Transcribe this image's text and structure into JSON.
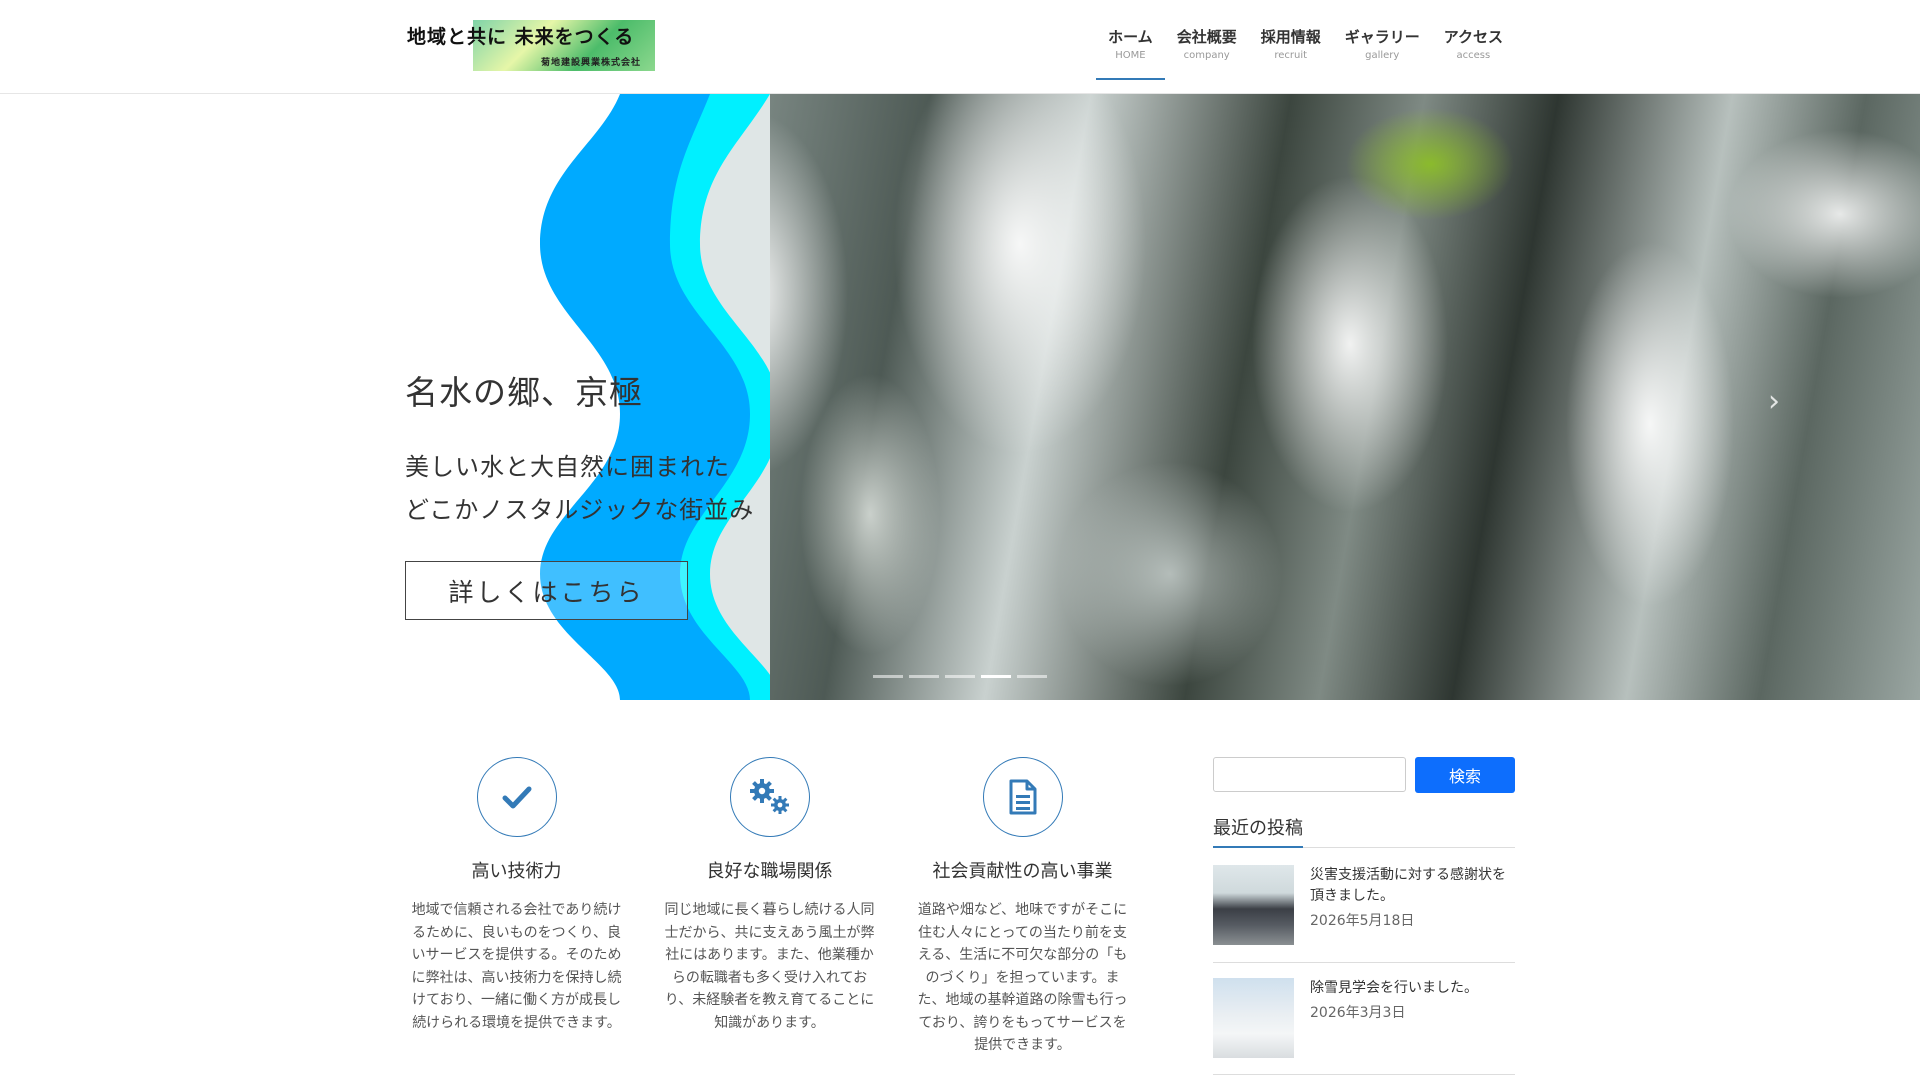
{
  "header": {
    "logo_text": "地域と共に 未来をつくる",
    "logo_company": "菊地建設興業株式会社",
    "nav": [
      {
        "label": "ホーム",
        "sub": "HOME",
        "active": true
      },
      {
        "label": "会社概要",
        "sub": "company"
      },
      {
        "label": "採用情報",
        "sub": "recruit"
      },
      {
        "label": "ギャラリー",
        "sub": "gallery"
      },
      {
        "label": "アクセス",
        "sub": "access"
      }
    ]
  },
  "hero": {
    "title": "名水の郷、京極",
    "line1": "美しい水と大自然に囲まれた",
    "line2": "どこかノスタルジックな街並み",
    "button": "詳しくはこちら",
    "slides_count": 5,
    "active_slide": 4,
    "colors": {
      "wave_dark": "#00aaff",
      "wave_light": "#00f0ff"
    }
  },
  "features": [
    {
      "icon": "check-icon",
      "title": "高い技術力",
      "text": "地域で信頼される会社であり続けるために、良いものをつくり、良いサービスを提供する。そのために弊社は、高い技術力を保持し続けており、一緒に働く方が成長し続けられる環境を提供できます。"
    },
    {
      "icon": "gears-icon",
      "title": "良好な職場関係",
      "text": "同じ地域に長く暮らし続ける人同士だから、共に支えあう風土が弊社にはあります。また、他業種からの転職者も多く受け入れており、未経験者を教え育てることに知識があります。"
    },
    {
      "icon": "document-icon",
      "title": "社会貢献性の高い事業",
      "text": "道路や畑など、地味ですがそこに住む人々にとっての当たり前を支える、生活に不可欠な部分の「ものづくり」を担っています。また、地域の基幹道路の除雪も行っており、誇りをもってサービスを提供できます。"
    }
  ],
  "sidebar": {
    "search_value": "",
    "search_button": "検索",
    "recent_title": "最近の投稿",
    "posts": [
      {
        "title": "災害支援活動に対する感謝状を頂きました。",
        "date": "2026年5月18日"
      },
      {
        "title": "除雪見学会を行いました。",
        "date": "2026年3月3日"
      }
    ]
  },
  "accent_color": "#337ab7",
  "button_color": "#0d6efd"
}
